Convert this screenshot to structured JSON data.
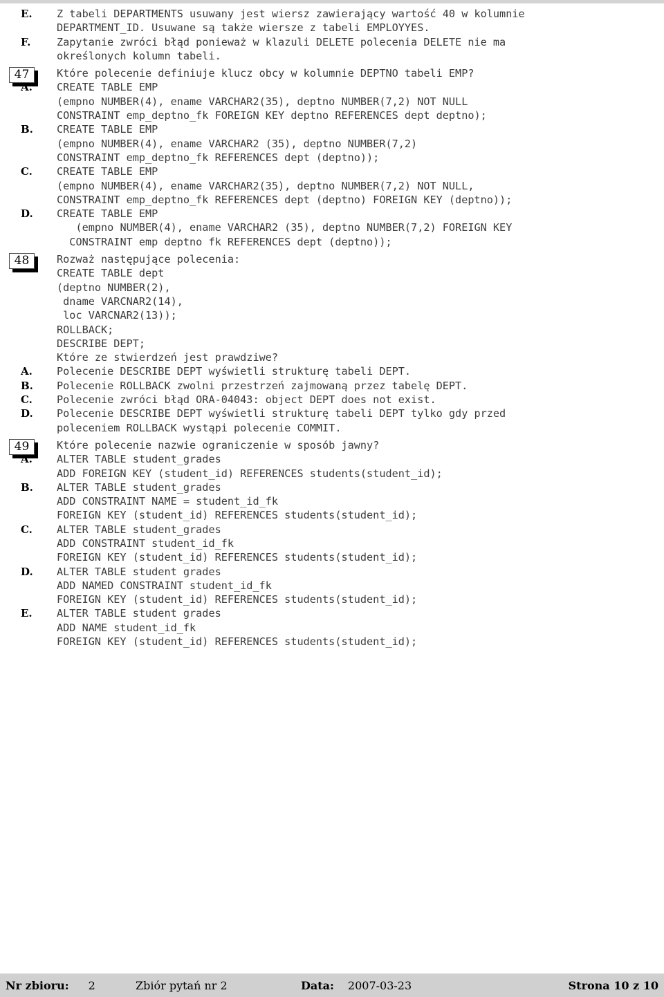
{
  "document": {
    "title": "Zbiór pytań nr 2",
    "page_label": "Strona 10 z 10"
  },
  "blocks": [
    {
      "marker": "E.",
      "kind": "option",
      "text": "Z tabeli DEPARTMENTS usuwany jest wiersz zawierający wartość 40 w kolumnie\nDEPARTMENT_ID. Usuwane są także wiersze z tabeli EMPLOYYES."
    },
    {
      "marker": "F.",
      "kind": "option",
      "text": "Zapytanie zwróci błąd ponieważ w klazuli DELETE polecenia DELETE nie ma\nokreślonych kolumn tabeli."
    },
    {
      "marker": "47",
      "kind": "question",
      "text": "Które polecenie definiuje klucz obcy w kolumnie DEPTNO tabeli EMP?"
    },
    {
      "marker": "A.",
      "kind": "option",
      "text": "CREATE TABLE EMP\n(empno NUMBER(4), ename VARCHAR2(35), deptno NUMBER(7,2) NOT NULL\nCONSTRAINT emp_deptno_fk FOREIGN KEY deptno REFERENCES dept deptno);"
    },
    {
      "marker": "B.",
      "kind": "option",
      "text": "CREATE TABLE EMP\n(empno NUMBER(4), ename VARCHAR2 (35), deptno NUMBER(7,2)\nCONSTRAINT emp_deptno_fk REFERENCES dept (deptno));"
    },
    {
      "marker": "C.",
      "kind": "option",
      "text": "CREATE TABLE EMP\n(empno NUMBER(4), ename VARCHAR2(35), deptno NUMBER(7,2) NOT NULL,\nCONSTRAINT emp_deptno_fk REFERENCES dept (deptno) FOREIGN KEY (deptno));"
    },
    {
      "marker": "D.",
      "kind": "option",
      "text": "CREATE TABLE EMP\n   (empno NUMBER(4), ename VARCHAR2 (35), deptno NUMBER(7,2) FOREIGN KEY\n  CONSTRAINT emp deptno fk REFERENCES dept (deptno));"
    },
    {
      "marker": "48",
      "kind": "question",
      "text": "Rozważ następujące polecenia:\nCREATE TABLE dept\n(deptno NUMBER(2),\n dname VARCNAR2(14),\n loc VARCNAR2(13));\nROLLBACK;\nDESCRIBE DEPT;\nKtóre ze stwierdzeń jest prawdziwe?"
    },
    {
      "marker": "A.",
      "kind": "option",
      "text": "Polecenie DESCRIBE DEPT wyświetli strukturę tabeli DEPT."
    },
    {
      "marker": "B.",
      "kind": "option",
      "text": "Polecenie ROLLBACK zwolni przestrzeń zajmowaną przez tabelę DEPT."
    },
    {
      "marker": "C.",
      "kind": "option",
      "text": "Polecenie zwróci błąd ORA-04043: object DEPT does not exist."
    },
    {
      "marker": "D.",
      "kind": "option",
      "text": "Polecenie DESCRIBE DEPT wyświetli strukturę tabeli DEPT tylko gdy przed\npoleceniem ROLLBACK wystąpi polecenie COMMIT."
    },
    {
      "marker": "49",
      "kind": "question",
      "text": "Które polecenie nazwie ograniczenie w sposób jawny?"
    },
    {
      "marker": "A.",
      "kind": "option",
      "text": "ALTER TABLE student_grades\nADD FOREIGN KEY (student_id) REFERENCES students(student_id);"
    },
    {
      "marker": "B.",
      "kind": "option",
      "text": "ALTER TABLE student_grades\nADD CONSTRAINT NAME = student_id_fk\nFOREIGN KEY (student_id) REFERENCES students(student_id);"
    },
    {
      "marker": "C.",
      "kind": "option",
      "text": "ALTER TABLE student_grades\nADD CONSTRAINT student_id_fk\nFOREIGN KEY (student_id) REFERENCES students(student_id);"
    },
    {
      "marker": "D.",
      "kind": "option",
      "text": "ALTER TABLE student grades\nADD NAMED CONSTRAINT student_id_fk\nFOREIGN KEY (student_id) REFERENCES students(student_id);"
    },
    {
      "marker": "E.",
      "kind": "option",
      "text": "ALTER TABLE student grades\nADD NAME student_id_fk\nFOREIGN KEY (student_id) REFERENCES students(student_id);"
    }
  ],
  "footer": {
    "set_label": "Nr zbioru:",
    "set_value": "2",
    "collection": "Zbiór pytań nr 2",
    "date_label": "Data:",
    "date_value": "2007-03-23",
    "page": "Strona 10 z 10"
  }
}
